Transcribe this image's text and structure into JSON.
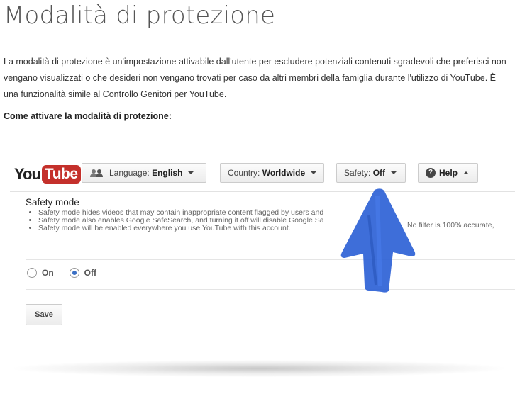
{
  "page": {
    "title": "Modalità di protezione",
    "intro": "La modalità di protezione è un'impostazione attivabile dall'utente per escludere potenziali contenuti sgradevoli che preferisci non vengano visualizzati o che desideri non vengano trovati per caso da altri membri della famiglia durante l'utilizzo di YouTube. È una funzionalità simile al Controllo Genitori per YouTube.",
    "howto_heading": "Come attivare la modalità di protezione:"
  },
  "screenshot": {
    "logo_you": "You",
    "logo_tube": "Tube",
    "topbar": {
      "language_label": "Language:",
      "language_value": "English",
      "country_label": "Country:",
      "country_value": "Worldwide",
      "safety_label": "Safety:",
      "safety_value": "Off",
      "help_label": "Help"
    },
    "panel": {
      "title": "Safety mode",
      "bullets": [
        "Safety mode hides videos that may contain inappropriate content flagged by users and",
        "Safety mode also enables Google SafeSearch, and turning it off will disable Google Sa",
        "Safety mode will be enabled everywhere you use YouTube with this account."
      ],
      "obscured_fragment": "No filter is 100% accurate,"
    },
    "options": {
      "on_label": "On",
      "off_label": "Off",
      "selected": "Off"
    },
    "save_label": "Save"
  },
  "colors": {
    "youtube_red": "#c4302b",
    "arrow_blue": "#2f63d6",
    "radio_selected": "#3a6fc4"
  },
  "icons": [
    "people-icon",
    "caret-down-icon",
    "help-icon",
    "caret-up-icon",
    "radio-icon",
    "arrow-up-icon"
  ]
}
